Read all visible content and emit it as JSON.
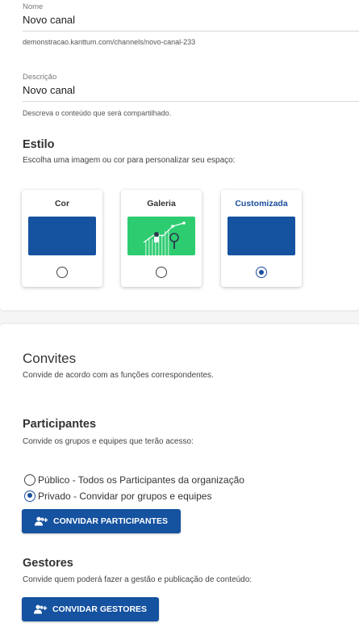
{
  "form": {
    "name": {
      "label": "Nome",
      "value": "Novo canal",
      "helper": "demonstracao.kanttum.com/channels/novo-canal-233"
    },
    "description": {
      "label": "Descrição",
      "value": "Novo canal",
      "helper": "Descreva o conteúdo que será compartilhado."
    }
  },
  "style": {
    "title": "Estilo",
    "subtitle": "Escolha uma imagem ou cor para personalizar seu espaço:",
    "options": [
      {
        "label": "Cor",
        "selected": false,
        "swatch": "#1552a0"
      },
      {
        "label": "Galeria",
        "selected": false,
        "swatch": "#2ecc71"
      },
      {
        "label": "Customizada",
        "selected": true,
        "swatch": "#1552a0"
      }
    ]
  },
  "invites": {
    "title": "Convites",
    "subtitle": "Convide de acordo com as funções correspondentes.",
    "participants": {
      "title": "Participantes",
      "subtitle": "Convide os grupos e equipes que terão acesso:",
      "options": [
        {
          "label": "Público - Todos os Participantes da organização",
          "selected": false
        },
        {
          "label": "Privado - Convidar por grupos e equipes",
          "selected": true
        }
      ],
      "button_label": "CONVIDAR PARTICIPANTES"
    },
    "managers": {
      "title": "Gestores",
      "subtitle": "Convide quem poderá fazer a gestão e publicação de conteúdo:",
      "button_label": "CONVIDAR GESTORES"
    }
  },
  "colors": {
    "accent": "#1552a0",
    "gallery_green": "#2ecc71"
  }
}
